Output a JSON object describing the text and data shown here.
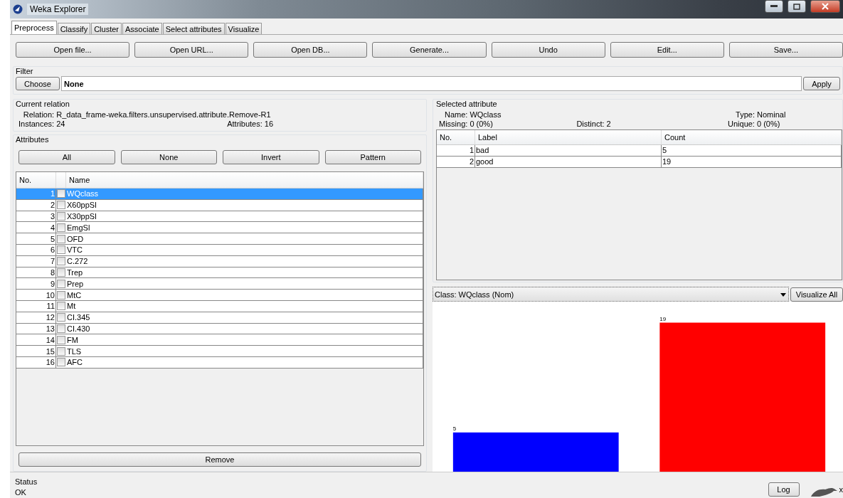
{
  "window": {
    "title": "Weka Explorer"
  },
  "tabs": [
    {
      "label": "Preprocess",
      "selected": true
    },
    {
      "label": "Classify",
      "selected": false
    },
    {
      "label": "Cluster",
      "selected": false
    },
    {
      "label": "Associate",
      "selected": false
    },
    {
      "label": "Select attributes",
      "selected": false
    },
    {
      "label": "Visualize",
      "selected": false
    }
  ],
  "toolbar": [
    "Open file...",
    "Open URL...",
    "Open DB...",
    "Generate...",
    "Undo",
    "Edit...",
    "Save..."
  ],
  "filter": {
    "title": "Filter",
    "choose": "Choose",
    "value": "None",
    "apply": "Apply"
  },
  "current_relation": {
    "title": "Current relation",
    "relation_label": "Relation:",
    "relation": "R_data_frame-weka.filters.unsupervised.attribute.Remove-R1",
    "instances_label": "Instances:",
    "instances": "24",
    "attributes_label": "Attributes:",
    "attributes": "16"
  },
  "attributes": {
    "title": "Attributes",
    "buttons": [
      "All",
      "None",
      "Invert",
      "Pattern"
    ],
    "columns": [
      "No.",
      "Name"
    ],
    "rows": [
      {
        "no": "1",
        "name": "WQclass",
        "selected": true,
        "checked": false
      },
      {
        "no": "2",
        "name": "X60ppSl",
        "selected": false,
        "checked": false
      },
      {
        "no": "3",
        "name": "X30ppSl",
        "selected": false,
        "checked": false
      },
      {
        "no": "4",
        "name": "EmgSl",
        "selected": false,
        "checked": false
      },
      {
        "no": "5",
        "name": "OFD",
        "selected": false,
        "checked": false
      },
      {
        "no": "6",
        "name": "VTC",
        "selected": false,
        "checked": false
      },
      {
        "no": "7",
        "name": "C.272",
        "selected": false,
        "checked": false
      },
      {
        "no": "8",
        "name": "Trep",
        "selected": false,
        "checked": false
      },
      {
        "no": "9",
        "name": "Prep",
        "selected": false,
        "checked": false
      },
      {
        "no": "10",
        "name": "MtC",
        "selected": false,
        "checked": false
      },
      {
        "no": "11",
        "name": "Mt",
        "selected": false,
        "checked": false
      },
      {
        "no": "12",
        "name": "CI.345",
        "selected": false,
        "checked": false
      },
      {
        "no": "13",
        "name": "CI.430",
        "selected": false,
        "checked": false
      },
      {
        "no": "14",
        "name": "FM",
        "selected": false,
        "checked": false
      },
      {
        "no": "15",
        "name": "TLS",
        "selected": false,
        "checked": false
      },
      {
        "no": "16",
        "name": "AFC",
        "selected": false,
        "checked": false
      }
    ],
    "remove": "Remove"
  },
  "selected_attribute": {
    "title": "Selected attribute",
    "name_label": "Name:",
    "name": "WQclass",
    "type_label": "Type:",
    "type": "Nominal",
    "missing_label": "Missing:",
    "missing": "0 (0%)",
    "distinct_label": "Distinct:",
    "distinct": "2",
    "unique_label": "Unique:",
    "unique": "0 (0%)",
    "columns": [
      "No.",
      "Label",
      "Count"
    ],
    "rows": [
      {
        "no": "1",
        "label": "bad",
        "count": "5"
      },
      {
        "no": "2",
        "label": "good",
        "count": "19"
      }
    ]
  },
  "class_select": {
    "value": "Class: WQclass (Nom)",
    "button": "Visualize All"
  },
  "chart_data": {
    "type": "bar",
    "data_labels": true,
    "categories": [
      null,
      null
    ],
    "series": [
      {
        "values": [
          5,
          19
        ],
        "colors": [
          "#0000ff",
          "#ff0000"
        ]
      }
    ]
  },
  "status": {
    "title": "Status",
    "text": "OK",
    "log": "Log",
    "count": "x"
  }
}
